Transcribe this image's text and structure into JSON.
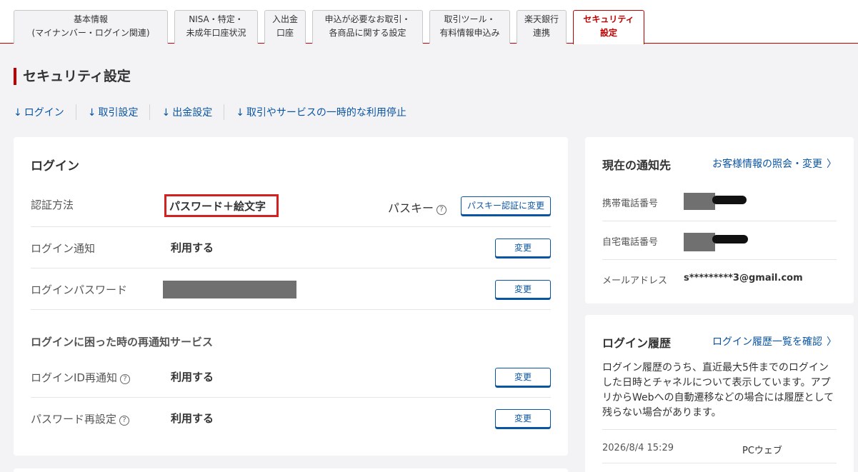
{
  "tabs": [
    {
      "line1": "基本情報",
      "line2": "(マイナンバー・ログイン関連)"
    },
    {
      "line1": "NISA・特定・",
      "line2": "未成年口座状況"
    },
    {
      "line1": "入出金",
      "line2": "口座"
    },
    {
      "line1": "申込が必要なお取引・",
      "line2": "各商品に関する設定"
    },
    {
      "line1": "取引ツール・",
      "line2": "有料情報申込み"
    },
    {
      "line1": "楽天銀行",
      "line2": "連携"
    },
    {
      "line1": "セキュリティ",
      "line2": "設定"
    }
  ],
  "page_title": "セキュリティ設定",
  "anchors": [
    {
      "arrow": "↓",
      "label": "ログイン"
    },
    {
      "arrow": "↓",
      "label": "取引設定"
    },
    {
      "arrow": "↓",
      "label": "出金設定"
    },
    {
      "arrow": "↓",
      "label": "取引やサービスの一時的な利用停止"
    }
  ],
  "login": {
    "title": "ログイン",
    "auth_label": "認証方法",
    "auth_value": "パスワード＋絵文字",
    "passkey_label": "パスキー",
    "passkey_button": "パスキー認証に変更",
    "notify_label": "ログイン通知",
    "notify_value": "利用する",
    "change": "変更",
    "password_label": "ログインパスワード",
    "recover_title": "ログインに困った時の再通知サービス",
    "id_reminder_label": "ログインID再通知",
    "id_reminder_value": "利用する",
    "pw_reset_label": "パスワード再設定",
    "pw_reset_value": "利用する",
    "help": "?"
  },
  "contact": {
    "title": "現在の通知先",
    "link": "お客様情報の照会・変更",
    "chev": "〉",
    "mobile_label": "携帯電話番号",
    "home_label": "自宅電話番号",
    "mail_label": "メールアドレス",
    "mail_value": "s*********3@gmail.com"
  },
  "history": {
    "title": "ログイン履歴",
    "link": "ログイン履歴一覧を確認",
    "chev": "〉",
    "desc": "ログイン履歴のうち、直近最大5件までのログインした日時とチャネルについて表示しています。アプリからWebへの自動遷移などの場合には履歴として残らない場合があります。",
    "entries": [
      {
        "datetime": "2026/8/4 15:29",
        "channel": "PCウェブ"
      }
    ]
  },
  "colors": {
    "accent": "#bf0000",
    "link": "#0a55a3",
    "highlight": "#d32020"
  }
}
